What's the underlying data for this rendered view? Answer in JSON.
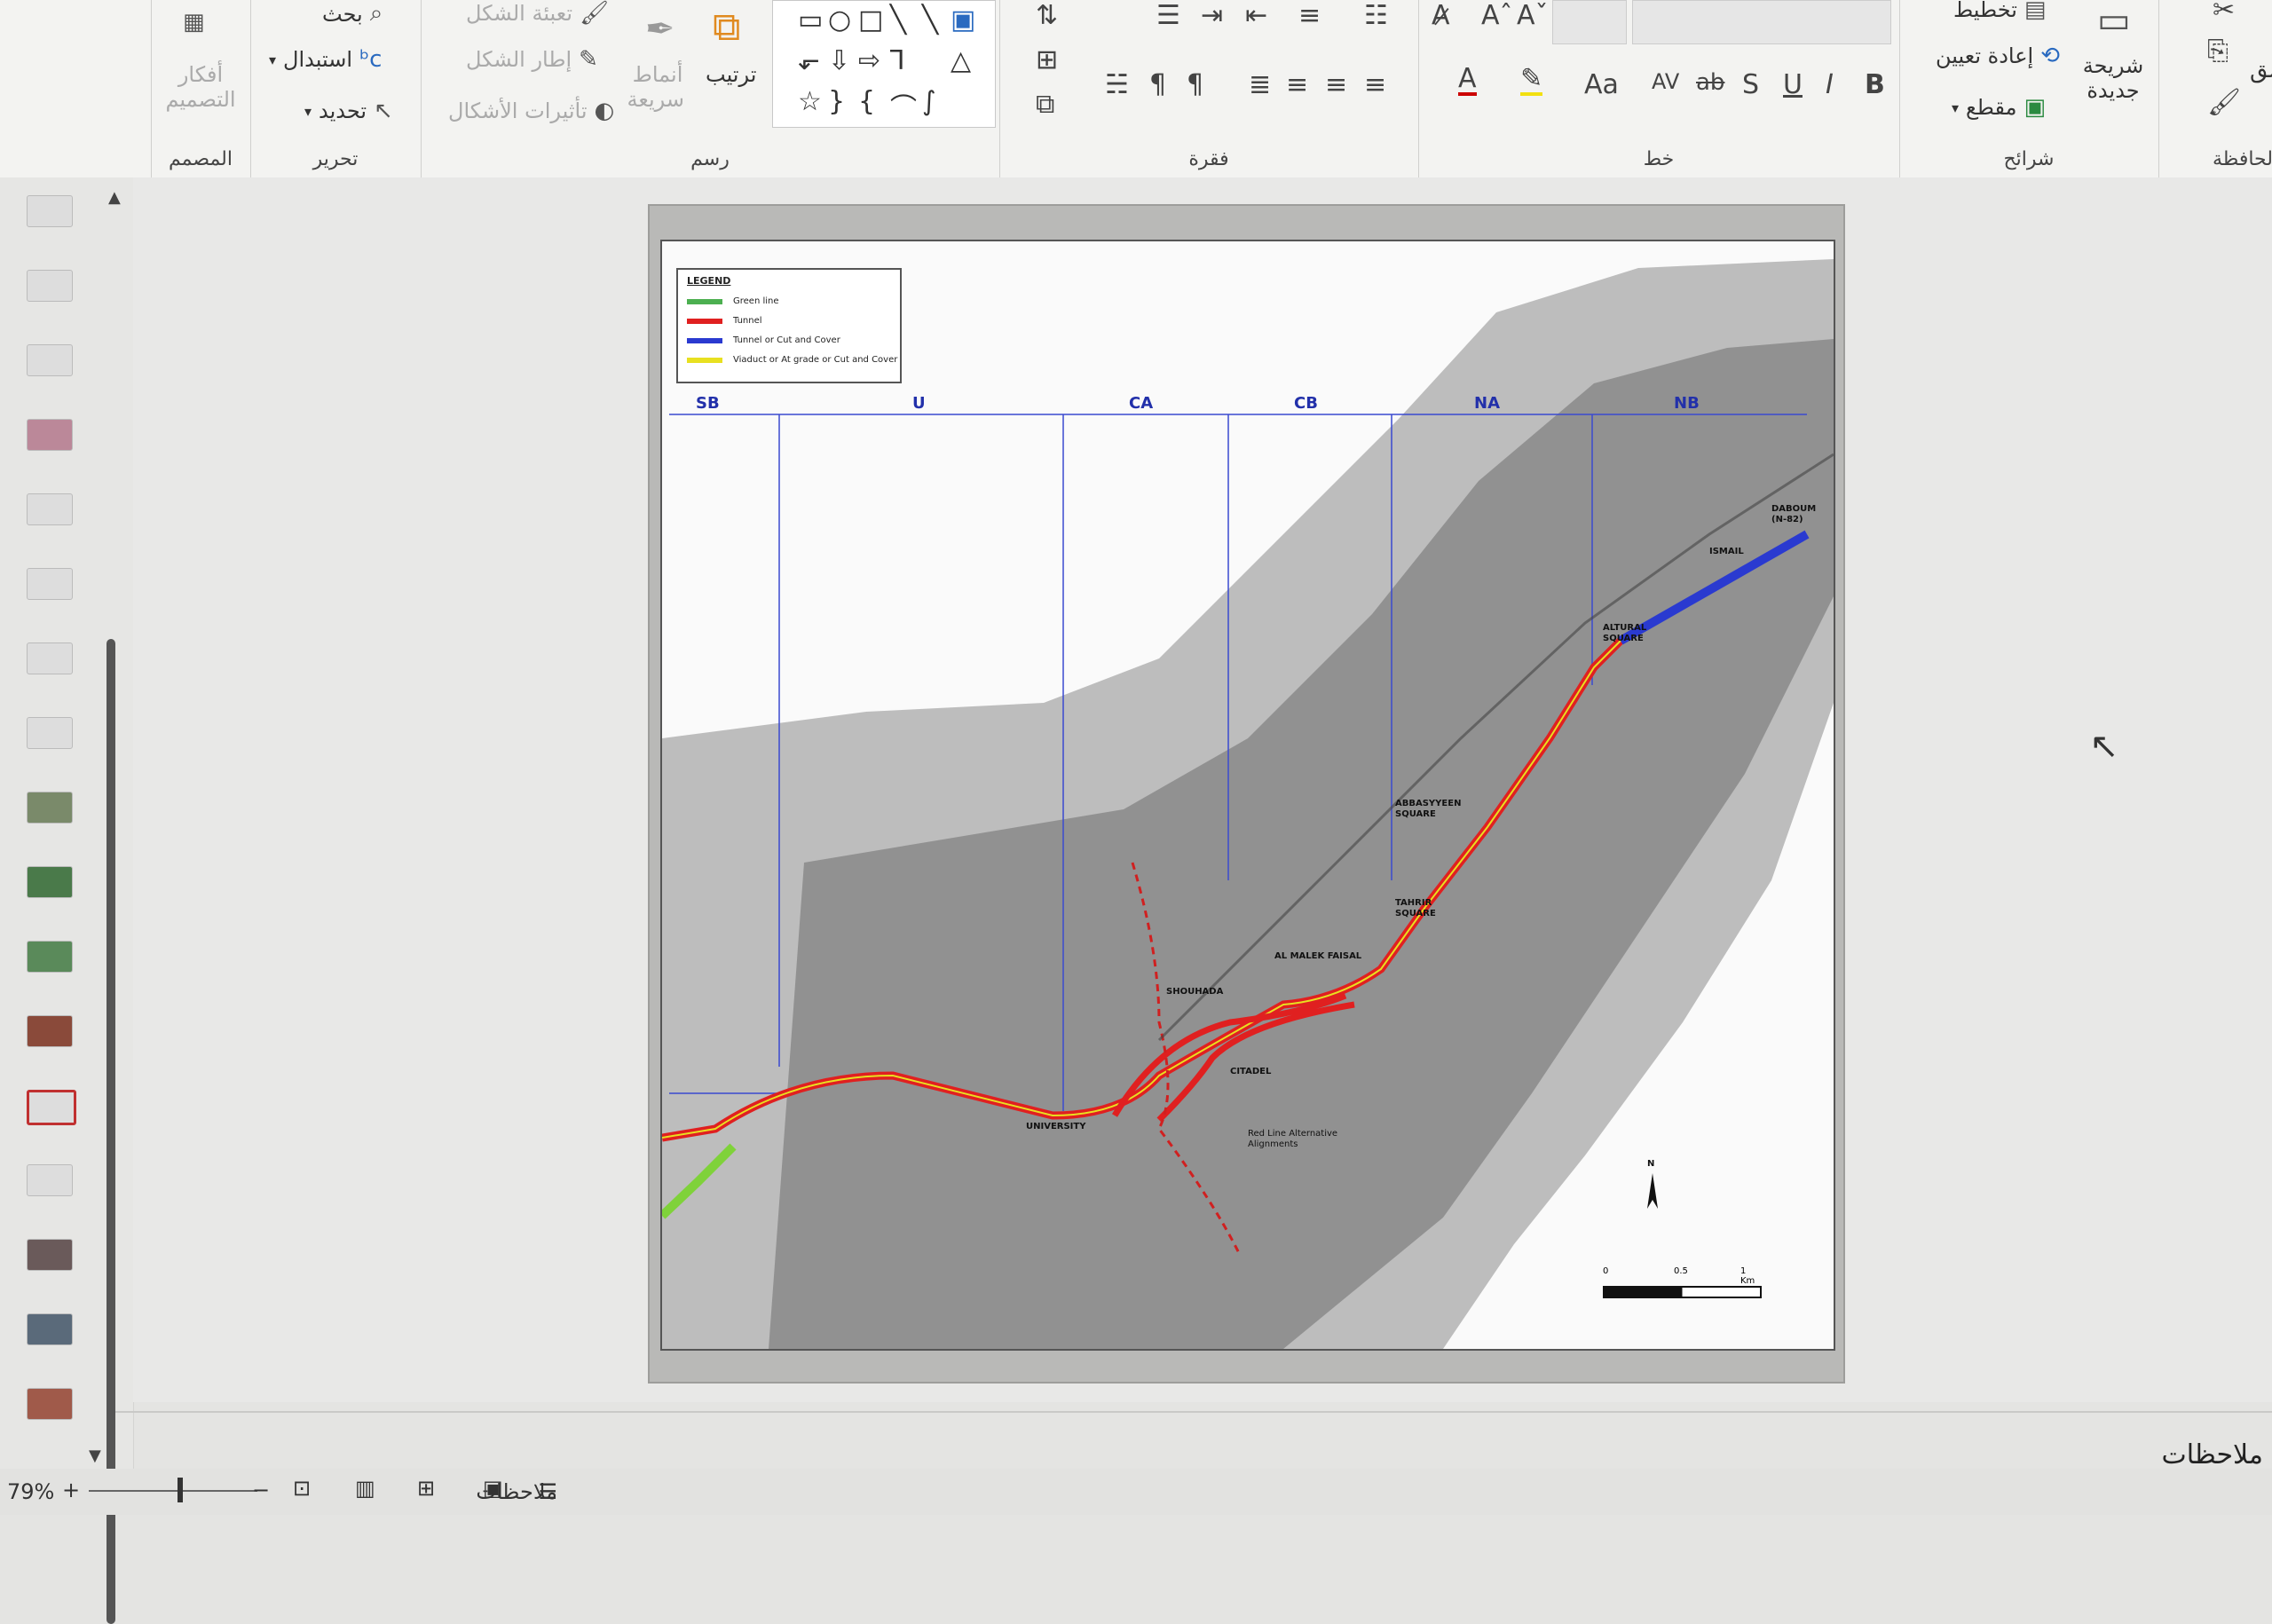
{
  "ribbon": {
    "groups": {
      "designer": "المصمم",
      "editing": "تحرير",
      "drawing": "رسم",
      "paragraph": "فقرة",
      "font": "خط",
      "slides": "شرائح",
      "clipboard": "الحافظة"
    },
    "designer": {
      "ideas": "أفكار التصميم"
    },
    "editing": {
      "find": "بحث",
      "replace": "استبدال",
      "select": "تحديد"
    },
    "drawing": {
      "fill": "تعبئة الشكل",
      "outline": "إطار الشكل",
      "effects": "تأثيرات الأشكال",
      "styles": "أنماط سريعة",
      "arrange": "ترتيب"
    },
    "font": {
      "bold": "B",
      "italic": "I",
      "underline": "U",
      "shadow": "S",
      "strike": "ab",
      "spacing": "AV",
      "case": "Aa"
    },
    "slides": {
      "layout": "تخطيط",
      "reset": "إعادة تعيين",
      "section": "مقطع",
      "new_slide": "شريحة جديدة"
    },
    "clipboard": {
      "paste": "لصق"
    }
  },
  "map": {
    "legend": {
      "title": "LEGEND",
      "items": [
        {
          "label": "Green line",
          "color": "#4caf50"
        },
        {
          "label": "Tunnel",
          "color": "#e02020"
        },
        {
          "label": "Tunnel or Cut and Cover",
          "color": "#2a3ad0"
        },
        {
          "label": "Viaduct or At grade or Cut and Cover",
          "color": "#e8e020"
        }
      ]
    },
    "sections": [
      "SB",
      "U",
      "CA",
      "CB",
      "NA",
      "NB"
    ],
    "stations": {
      "daboum": "DABOUM (N-82)",
      "ismail": "ISMAIL",
      "altural": "ALTURAL SQUARE",
      "abbassyeen": "ABBASYYEEN SQUARE",
      "tahrir": "TAHRIR SQUARE",
      "malek": "AL MALEK FAISAL",
      "shohada": "SHOUHADA",
      "citadel": "CITADEL",
      "university": "UNIVERSITY",
      "red_line": "Red Line Alternative Alignments"
    },
    "scale": {
      "zero": "0",
      "half": "0.5",
      "one": "1 Km",
      "north": "N"
    }
  },
  "notes_label": "ملاحظات",
  "status": {
    "zoom": "79%",
    "notes_btn": "ملاحظات"
  },
  "colors": {
    "accent": "#c03030",
    "tunnel": "#e02020",
    "viaduct": "#e8e020",
    "cutcover": "#2a3ad0",
    "green": "#7fd23a"
  }
}
